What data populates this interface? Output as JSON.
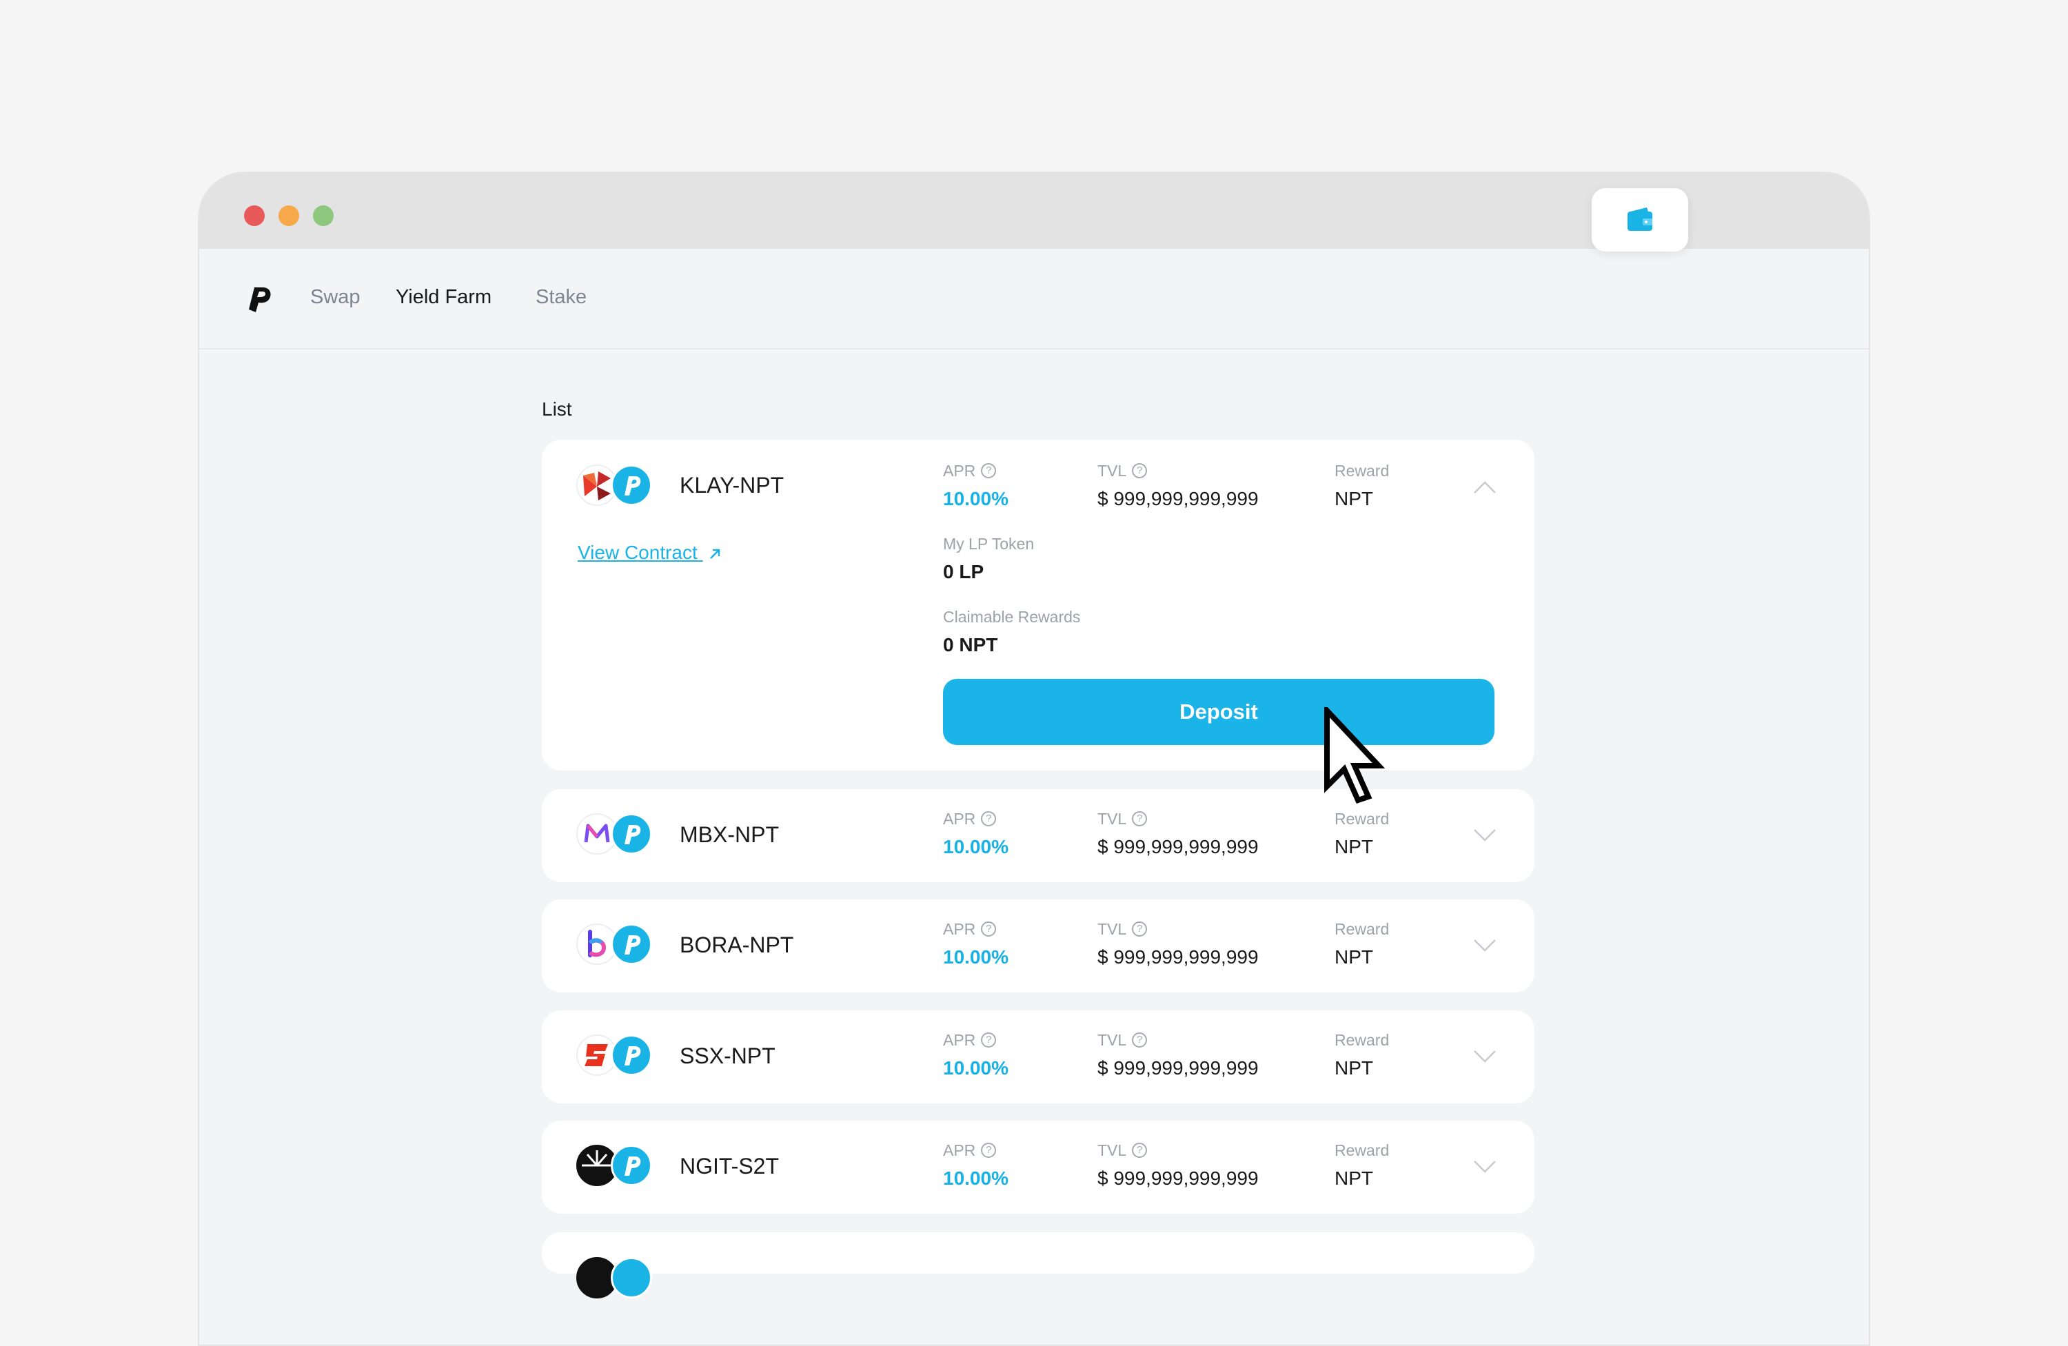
{
  "nav": {
    "items": [
      {
        "label": "Swap",
        "active": false
      },
      {
        "label": "Yield Farm",
        "active": true
      },
      {
        "label": "Stake",
        "active": false
      }
    ]
  },
  "list": {
    "title": "List"
  },
  "labels": {
    "apr": "APR",
    "tvl": "TVL",
    "reward": "Reward",
    "help": "?"
  },
  "farms": [
    {
      "name": "KLAY-NPT",
      "apr": "10.00%",
      "tvl": "$ 999,999,999,999",
      "reward": "NPT",
      "expanded": true,
      "view_contract": "View Contract",
      "my_lp_label": "My LP Token",
      "my_lp_value": "0 LP",
      "claimable_label": "Claimable Rewards",
      "claimable_value": "0 NPT",
      "deposit_label": "Deposit"
    },
    {
      "name": "MBX-NPT",
      "apr": "10.00%",
      "tvl": "$ 999,999,999,999",
      "reward": "NPT",
      "expanded": false
    },
    {
      "name": "BORA-NPT",
      "apr": "10.00%",
      "tvl": "$ 999,999,999,999",
      "reward": "NPT",
      "expanded": false
    },
    {
      "name": "SSX-NPT",
      "apr": "10.00%",
      "tvl": "$ 999,999,999,999",
      "reward": "NPT",
      "expanded": false
    },
    {
      "name": "NGIT-S2T",
      "apr": "10.00%",
      "tvl": "$ 999,999,999,999",
      "reward": "NPT",
      "expanded": false
    }
  ],
  "colors": {
    "accent": "#1bb4e8",
    "window_bg": "#f3f4f5",
    "card_bg": "#ffffff"
  }
}
